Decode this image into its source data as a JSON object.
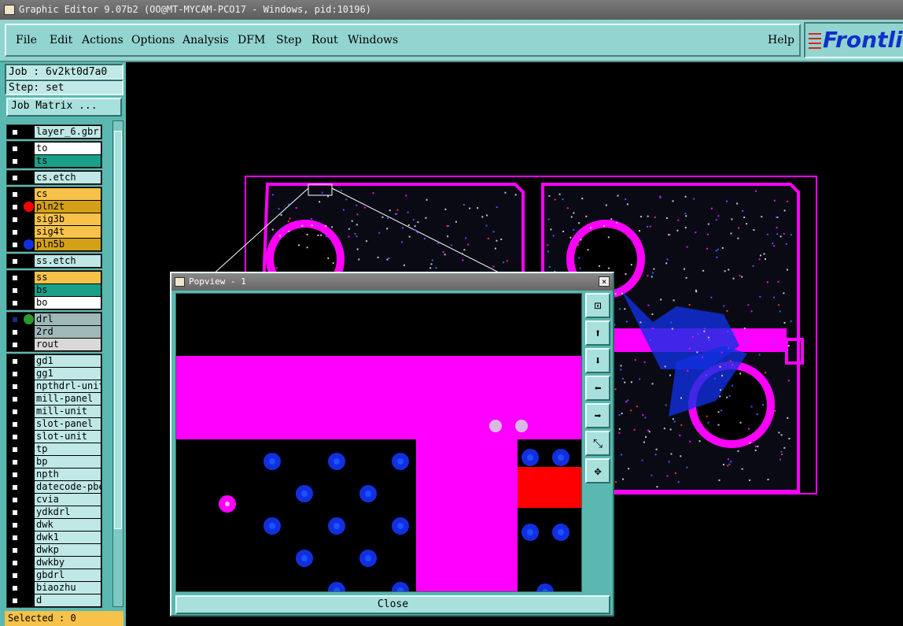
{
  "window": {
    "title": "Graphic Editor 9.07b2 (OO@MT-MYCAM-PCO17 - Windows, pid:10196)"
  },
  "menu": {
    "items": [
      "File",
      "Edit",
      "Actions",
      "Options",
      "Analysis",
      "DFM",
      "Step",
      "Rout",
      "Windows"
    ],
    "help": "Help",
    "logo": "Frontli"
  },
  "job": {
    "job_label": "Job : 6v2kt0d7a0",
    "step_label": "Step: set",
    "matrix_button": "Job Matrix ..."
  },
  "layers": [
    {
      "name": "layer_6.gbr",
      "bg": "#bfe8e6",
      "dot": "",
      "arrow": "⬇"
    },
    {
      "name": "to",
      "bg": "#ffffff",
      "dot": ""
    },
    {
      "name": "ts",
      "bg": "#1aa089",
      "dot": ""
    },
    {
      "name": "cs.etch",
      "bg": "#bfe8e6",
      "dot": ""
    },
    {
      "name": "cs",
      "bg": "#f6c24a",
      "dot": ""
    },
    {
      "name": "pln2t",
      "bg": "#d4a017",
      "dot": "#ff0000"
    },
    {
      "name": "sig3b",
      "bg": "#f6c24a",
      "dot": ""
    },
    {
      "name": "sig4t",
      "bg": "#f6c24a",
      "dot": ""
    },
    {
      "name": "pln5b",
      "bg": "#d4a017",
      "dot": "#1030e0"
    },
    {
      "name": "ss.etch",
      "bg": "#bfe8e6",
      "dot": ""
    },
    {
      "name": "ss",
      "bg": "#f6c24a",
      "dot": ""
    },
    {
      "name": "bs",
      "bg": "#1aa089",
      "dot": ""
    },
    {
      "name": "bo",
      "bg": "#ffffff",
      "dot": ""
    },
    {
      "name": "drl",
      "bg": "#9fb8b8",
      "dot": "#2a9a2a"
    },
    {
      "name": "2rd",
      "bg": "#9fb8b8",
      "dot": ""
    },
    {
      "name": "rout",
      "bg": "#d9d9d9",
      "dot": ""
    },
    {
      "name": "gd1",
      "bg": "#bfe8e6",
      "dot": ""
    },
    {
      "name": "gg1",
      "bg": "#bfe8e6",
      "dot": ""
    },
    {
      "name": "npthdrl-unit",
      "bg": "#bfe8e6",
      "dot": ""
    },
    {
      "name": "mill-panel",
      "bg": "#bfe8e6",
      "dot": ""
    },
    {
      "name": "mill-unit",
      "bg": "#bfe8e6",
      "dot": ""
    },
    {
      "name": "slot-panel",
      "bg": "#bfe8e6",
      "dot": ""
    },
    {
      "name": "slot-unit",
      "bg": "#bfe8e6",
      "dot": ""
    },
    {
      "name": "tp",
      "bg": "#bfe8e6",
      "dot": ""
    },
    {
      "name": "bp",
      "bg": "#bfe8e6",
      "dot": ""
    },
    {
      "name": "npth",
      "bg": "#bfe8e6",
      "dot": ""
    },
    {
      "name": "datecode-pbe",
      "bg": "#bfe8e6",
      "dot": ""
    },
    {
      "name": "cvia",
      "bg": "#bfe8e6",
      "dot": ""
    },
    {
      "name": "ydkdrl",
      "bg": "#bfe8e6",
      "dot": ""
    },
    {
      "name": "dwk",
      "bg": "#bfe8e6",
      "dot": ""
    },
    {
      "name": "dwk1",
      "bg": "#bfe8e6",
      "dot": ""
    },
    {
      "name": "dwkp",
      "bg": "#bfe8e6",
      "dot": ""
    },
    {
      "name": "dwkby",
      "bg": "#bfe8e6",
      "dot": ""
    },
    {
      "name": "gbdrl",
      "bg": "#bfe8e6",
      "dot": ""
    },
    {
      "name": "biaozhu",
      "bg": "#bfe8e6",
      "dot": ""
    },
    {
      "name": "d",
      "bg": "#bfe8e6",
      "dot": ""
    }
  ],
  "status": {
    "selected": "Selected : 0"
  },
  "popview": {
    "title": "Popview - 1",
    "close_x": "×",
    "close_button": "Close",
    "tools": [
      "zoom-fit-icon",
      "pan-up-icon",
      "pan-down-icon",
      "pan-left-icon",
      "pan-right-icon",
      "zoom-out-icon",
      "zoom-home-icon"
    ]
  },
  "colors": {
    "copper": "#ff00ff",
    "via": "#1030e0",
    "pad": "#ff0000",
    "panel": "#5ab8b0"
  }
}
